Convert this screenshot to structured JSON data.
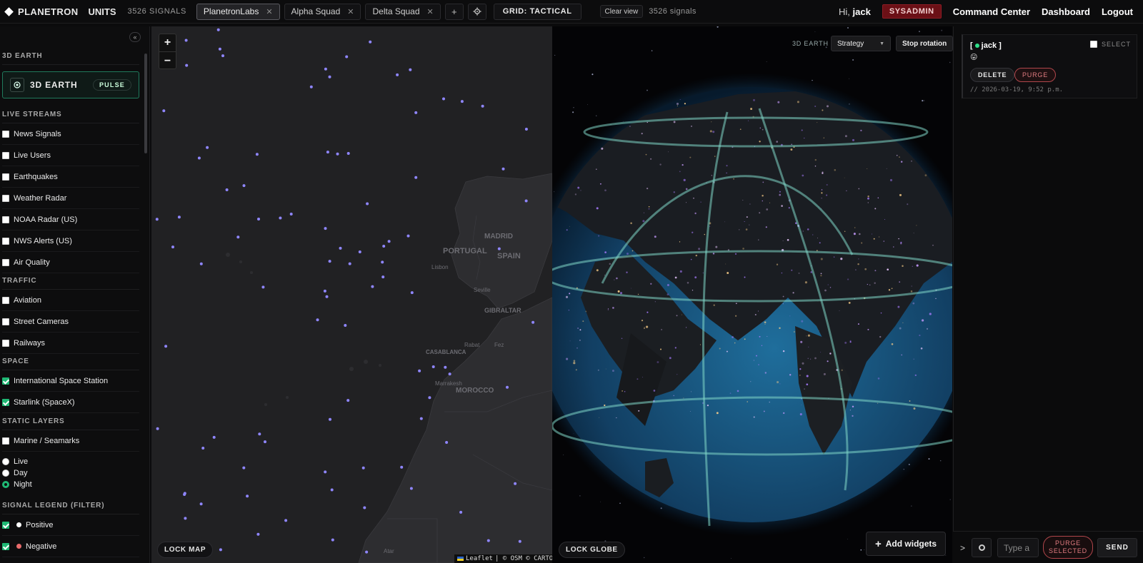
{
  "header": {
    "brand": "PLANETRON",
    "units": "UNITS",
    "signal_count": "3526 SIGNALS",
    "tabs": [
      {
        "label": "PlanetronLabs",
        "active": true
      },
      {
        "label": "Alpha Squad",
        "active": false
      },
      {
        "label": "Delta Squad",
        "active": false
      }
    ],
    "add_tab": "+",
    "grid_label": "GRID: TACTICAL",
    "clear_view": "Clear view",
    "signals_small": "3526 signals",
    "greeting": "Hi,",
    "username": "jack",
    "role_badge": "SYSADMIN",
    "nav": [
      "Command Center",
      "Dashboard",
      "Logout"
    ]
  },
  "sidebar": {
    "collapse_icon": "«",
    "section_3d": "3D EARTH",
    "earth_card": {
      "label": "3D EARTH",
      "pulse": "PULSE"
    },
    "live_streams": {
      "title": "LIVE STREAMS",
      "items": [
        {
          "label": "News Signals",
          "checked": false
        },
        {
          "label": "Live Users",
          "checked": false
        },
        {
          "label": "Earthquakes",
          "checked": false
        },
        {
          "label": "Weather Radar",
          "checked": false
        },
        {
          "label": "NOAA Radar (US)",
          "checked": false
        },
        {
          "label": "NWS Alerts (US)",
          "checked": false
        },
        {
          "label": "Air Quality",
          "checked": false
        }
      ]
    },
    "traffic": {
      "title": "TRAFFIC",
      "items": [
        {
          "label": "Aviation",
          "checked": false
        },
        {
          "label": "Street Cameras",
          "checked": false
        },
        {
          "label": "Railways",
          "checked": false
        }
      ]
    },
    "space": {
      "title": "SPACE",
      "items": [
        {
          "label": "International Space Station",
          "checked": true
        },
        {
          "label": "Starlink (SpaceX)",
          "checked": true
        }
      ]
    },
    "static_layers": {
      "title": "STATIC LAYERS",
      "items": [
        {
          "label": "Marine / Seamarks",
          "checked": false
        }
      ],
      "modes": [
        {
          "label": "Live",
          "selected": false
        },
        {
          "label": "Day",
          "selected": false
        },
        {
          "label": "Night",
          "selected": true
        }
      ]
    },
    "legend": {
      "title": "SIGNAL LEGEND (FILTER)",
      "items": [
        {
          "label": "Positive",
          "checked": true,
          "color": "#ffffff"
        },
        {
          "label": "Negative",
          "checked": true,
          "color": "#e86b6b"
        }
      ]
    }
  },
  "map": {
    "zoom_in": "+",
    "zoom_out": "−",
    "lock_label": "LOCK MAP",
    "attribution_leaflet": "Leaflet",
    "attribution_rest": "| © OSM © CARTO",
    "labels": [
      "MADRID",
      "PORTUGAL",
      "SPAIN",
      "Lisbon",
      "Seville",
      "GIBRALTAR",
      "Rabat",
      "Fez",
      "CASABLANCA",
      "Marrakesh",
      "MOROCCO",
      "Atar"
    ],
    "signal_color": "#8f86ff"
  },
  "globe": {
    "label": "3D EARTH",
    "mode": "Strategy",
    "stop_rotation": "Stop rotation",
    "lock_label": "LOCK GLOBE",
    "add_widgets": "Add widgets",
    "add_icon": "+"
  },
  "chat": {
    "message": {
      "open_bracket": "[",
      "name": "jack",
      "close_bracket": "]",
      "emoji": "😛",
      "select_label": "SELECT",
      "delete_label": "DELETE",
      "purge_label": "PURGE",
      "timestamp": "// 2026-03-19, 9:52 p.m."
    },
    "prompt": ">",
    "input_placeholder": "Type a",
    "purge_selected": "PURGE SELECTED",
    "send": "SEND"
  }
}
